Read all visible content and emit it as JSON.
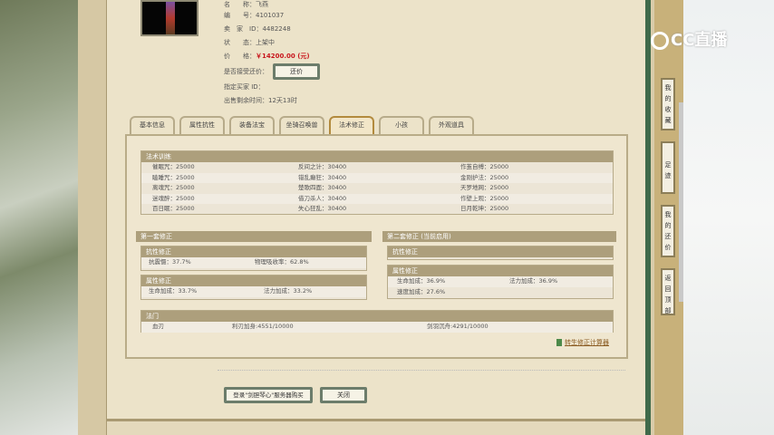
{
  "item": {
    "name_label": "名　　称：",
    "name_value": "飞燕",
    "id_label": "编　　号：",
    "id_value": "4101037",
    "seller_label": "卖　家　ID：",
    "seller_value": "4482248",
    "status_label": "状　　态：",
    "status_value": "上架中",
    "price_label": "价　　格：",
    "price_value": "￥14200.00 (元)",
    "bargain_label": "是否接受还价：",
    "bargain_button": "还价",
    "buyer_label": "指定买家 ID：",
    "time_label": "出售剩余时间：",
    "time_value": "12天13时"
  },
  "tabs": [
    {
      "label": "基本信息"
    },
    {
      "label": "属性抗性"
    },
    {
      "label": "装备法宝"
    },
    {
      "label": "坐骑召唤兽"
    },
    {
      "label": "法术修正",
      "active": true
    },
    {
      "label": "小孩"
    },
    {
      "label": "外观道具"
    }
  ],
  "spell_training": {
    "title": "法术训练",
    "rows": [
      [
        "催眠咒：25000",
        "反间之计：30400",
        "作茧自缚：25000"
      ],
      [
        "瞌睡咒：25000",
        "错乱癫狂：30400",
        "金刚护法：25000"
      ],
      [
        "离魂咒：25000",
        "楚歌四面：30400",
        "天罗地网：25000"
      ],
      [
        "迷魂醉：25000",
        "借刀杀人：30400",
        "作壁上观：25000"
      ],
      [
        "百日眠：25000",
        "失心狂乱：30400",
        "日月乾坤：25000"
      ]
    ]
  },
  "set1": {
    "title": "第一套修正",
    "resist_title": "抗性修正",
    "resist": [
      "抗震慑：37.7%",
      "物理吸收率：62.8%"
    ],
    "attr_title": "属性修正",
    "attr": [
      "生命加成：33.7%",
      "法力加成：33.2%"
    ]
  },
  "set2": {
    "title": "第二套修正 (当前启用)",
    "resist_title": "抗性修正",
    "attr_title": "属性修正",
    "attr": [
      "生命加成：36.9%",
      "法力加成：36.9%",
      "速度加成：27.6%"
    ]
  },
  "fa": {
    "title": "法门",
    "rows": [
      [
        "血刃",
        "利刃加身:4551/10000",
        "剑羽沉舟:4291/10000"
      ]
    ]
  },
  "calc_link": "转生修正计算器",
  "buttons": {
    "login": "登录\"剑胆琴心\"服务器购买",
    "close": "关闭"
  },
  "side_nav": [
    {
      "label": "我的收藏"
    },
    {
      "label": "足迹"
    },
    {
      "label": "我的还价"
    },
    {
      "label": "返回顶部"
    }
  ],
  "logo": "CC直播",
  "colors": {
    "price": "#c8161d",
    "header": "#ad9f7c"
  }
}
